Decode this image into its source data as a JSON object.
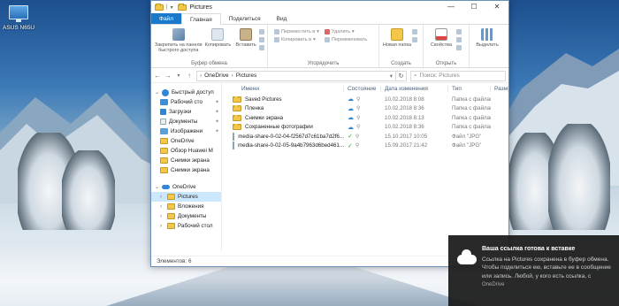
{
  "desktop": {
    "icon_label": "ASUS N65U"
  },
  "window": {
    "title": "Pictures",
    "tabs": [
      "Файл",
      "Главная",
      "Поделиться",
      "Вид"
    ],
    "controls": {
      "minimize": "—",
      "maximize": "☐",
      "close": "✕"
    }
  },
  "ribbon": {
    "clipboard": {
      "pin_label": "Закрепить на панели быстрого доступа",
      "copy_label": "Копировать",
      "paste_label": "Вставить",
      "group_name": "Буфер обмена"
    },
    "organize": {
      "move_label": "Переместить в",
      "copyto_label": "Копировать в",
      "delete_label": "Удалить",
      "rename_label": "Переименовать",
      "group_name": "Упорядочить"
    },
    "create": {
      "newfolder_label": "Новая папка",
      "group_name": "Создать"
    },
    "open": {
      "props_label": "Свойства",
      "group_name": "Открыть"
    },
    "select": {
      "select_label": "Выделить"
    }
  },
  "address": {
    "path": [
      "OneDrive",
      "Pictures"
    ],
    "search_placeholder": "Поиск: Pictures"
  },
  "nav": {
    "quick_access": "Быстрый доступ",
    "items": [
      {
        "label": "Рабочий сто",
        "icon": "desktop-icon"
      },
      {
        "label": "Загрузки",
        "icon": "downloads-icon"
      },
      {
        "label": "Документы",
        "icon": "documents-icon"
      },
      {
        "label": "Изображени",
        "icon": "pictures-icon"
      },
      {
        "label": "OneDrive",
        "icon": "onedrive-icon"
      },
      {
        "label": "Обзор Huawei M",
        "icon": "folder-icon"
      },
      {
        "label": "Снимки экрана",
        "icon": "folder-icon"
      },
      {
        "label": "Снимки экрана",
        "icon": "folder-icon"
      }
    ],
    "onedrive": "OneDrive",
    "onedrive_children": [
      "Pictures",
      "Вложения",
      "Документы",
      "Рабочий стол"
    ]
  },
  "columns": {
    "name": "Имени",
    "state": "Состояние",
    "date": "Дата изменения",
    "type": "Тип",
    "size": "Разм"
  },
  "files": [
    {
      "name": "Saved Pictures",
      "kind": "folder",
      "date": "10.02.2018 8:08",
      "type": "Папка с файлами"
    },
    {
      "name": "Пленка",
      "kind": "folder",
      "date": "10.02.2018 8:36",
      "type": "Папка с файлами"
    },
    {
      "name": "Снимки экрана",
      "kind": "folder",
      "date": "10.02.2018 8:13",
      "type": "Папка с файлами"
    },
    {
      "name": "Сохраненные фотографии",
      "kind": "folder",
      "date": "10.02.2018 8:36",
      "type": "Папка с файлами"
    },
    {
      "name": "media-share-0-02-04-f2567d7c61ba7d2f6...",
      "kind": "file",
      "date": "15.10.2017 10:05",
      "type": "Файл \"JPG\""
    },
    {
      "name": "media-share-0-02-05-9a4b7963d6bed461...",
      "kind": "file",
      "date": "15.09.2017 21:42",
      "type": "Файл \"JPG\""
    }
  ],
  "status": {
    "count": "Элементов: 6"
  },
  "toast": {
    "title": "Ваша ссылка готова к вставке",
    "body": "Ссылка на Pictures сохранена в буфер обмена. Чтобы поделиться ею, вставьте ее в сообщение или запись. Любой, у кого есть ссылка, с",
    "app": "OneDrive"
  },
  "colors": {
    "accent": "#1979ca",
    "selection": "#cce8ff",
    "folder": "#f3c74a"
  }
}
